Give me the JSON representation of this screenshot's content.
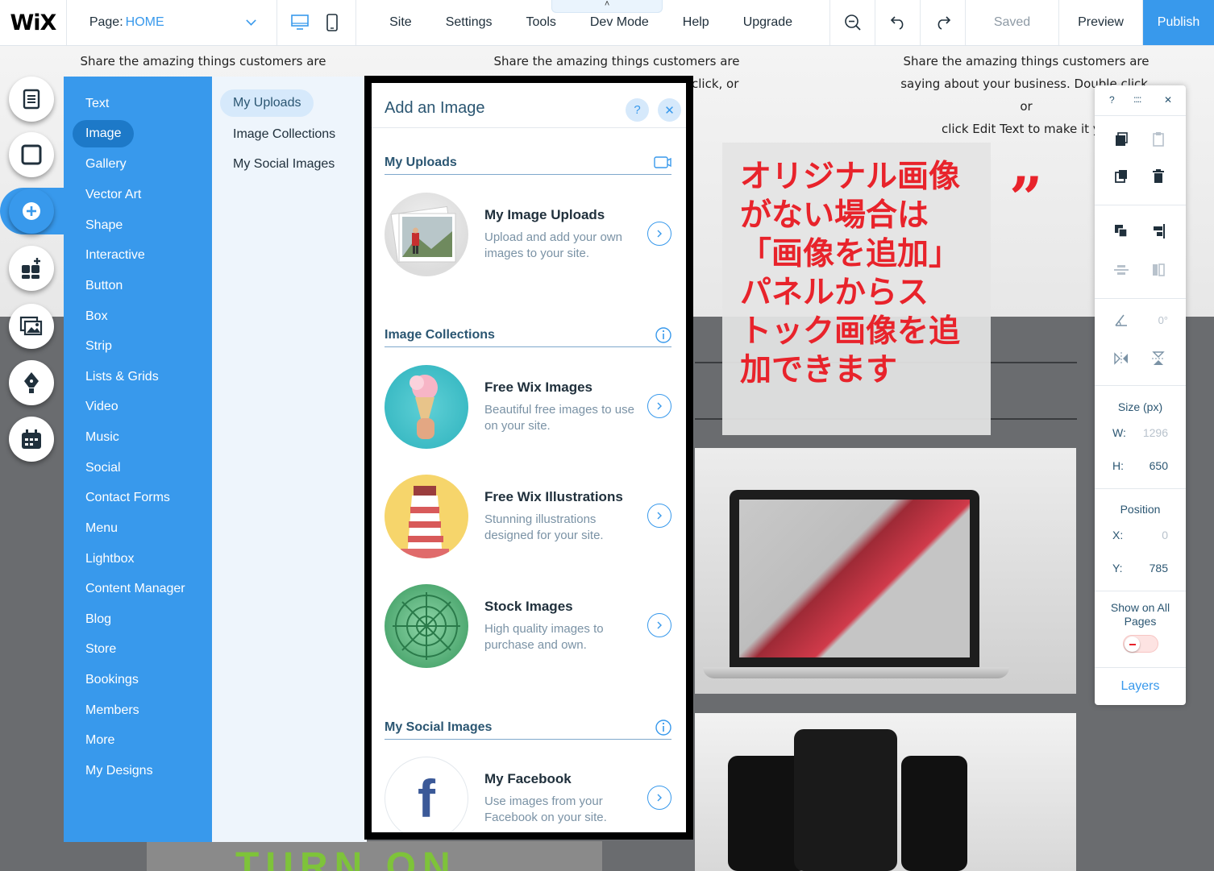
{
  "topbar": {
    "logo": "WiX",
    "page_label": "Page:",
    "page_value": "HOME",
    "menus": [
      "Site",
      "Settings",
      "Tools",
      "Dev Mode",
      "Help",
      "Upgrade"
    ],
    "dev_handle": "˄",
    "saved": "Saved",
    "preview": "Preview",
    "publish": "Publish"
  },
  "canvas": {
    "quote1": "Share the amazing things customers are saying",
    "quote2_l1": "Share the amazing things customers are",
    "quote2_l2": "click, or",
    "quote3_l1": "Share the amazing things customers are",
    "quote3_l2": "saying about your business. Double click, or",
    "quote3_l3": "click Edit Text to make it you",
    "turn_on": "TURN ON"
  },
  "annotation": {
    "text_lines": [
      "オリジナル画像",
      "がない場合は",
      "「画像を追加」",
      "パネルからス",
      "トック画像を追",
      "加できます"
    ],
    "quote_mark": "”"
  },
  "add_panel": {
    "categories": [
      "Text",
      "Image",
      "Gallery",
      "Vector Art",
      "Shape",
      "Interactive",
      "Button",
      "Box",
      "Strip",
      "Lists & Grids",
      "Video",
      "Music",
      "Social",
      "Contact Forms",
      "Menu",
      "Lightbox",
      "Content Manager",
      "Blog",
      "Store",
      "Bookings",
      "Members",
      "More",
      "My Designs"
    ],
    "subcategories": [
      "My Uploads",
      "Image Collections",
      "My Social Images"
    ]
  },
  "image_panel": {
    "title": "Add an Image",
    "help": "?",
    "close": "✕",
    "sections": {
      "uploads": "My Uploads",
      "collections": "Image Collections",
      "social": "My Social Images"
    },
    "items": [
      {
        "title": "My Image Uploads",
        "desc": "Upload and add your own images to your site."
      },
      {
        "title": "Free Wix Images",
        "desc": "Beautiful free images to use on your site."
      },
      {
        "title": "Free Wix Illustrations",
        "desc": "Stunning illustrations designed for your site."
      },
      {
        "title": "Stock Images",
        "desc": "High quality images to purchase and own."
      },
      {
        "title": "My Facebook",
        "desc": "Use images from your Facebook on your site."
      }
    ],
    "facebook_glyph": "f"
  },
  "props_panel": {
    "help": "?",
    "grip": "::::",
    "close": "✕",
    "rotation": "0°",
    "size_label": "Size (px)",
    "w_label": "W:",
    "w_value": "1296",
    "h_label": "H:",
    "h_value": "650",
    "position_label": "Position",
    "x_label": "X:",
    "x_value": "0",
    "y_label": "Y:",
    "y_value": "785",
    "show_all_label": "Show on All Pages",
    "layers": "Layers"
  },
  "colors": {
    "accent": "#3899ec",
    "annotation_red": "#e8232b"
  }
}
